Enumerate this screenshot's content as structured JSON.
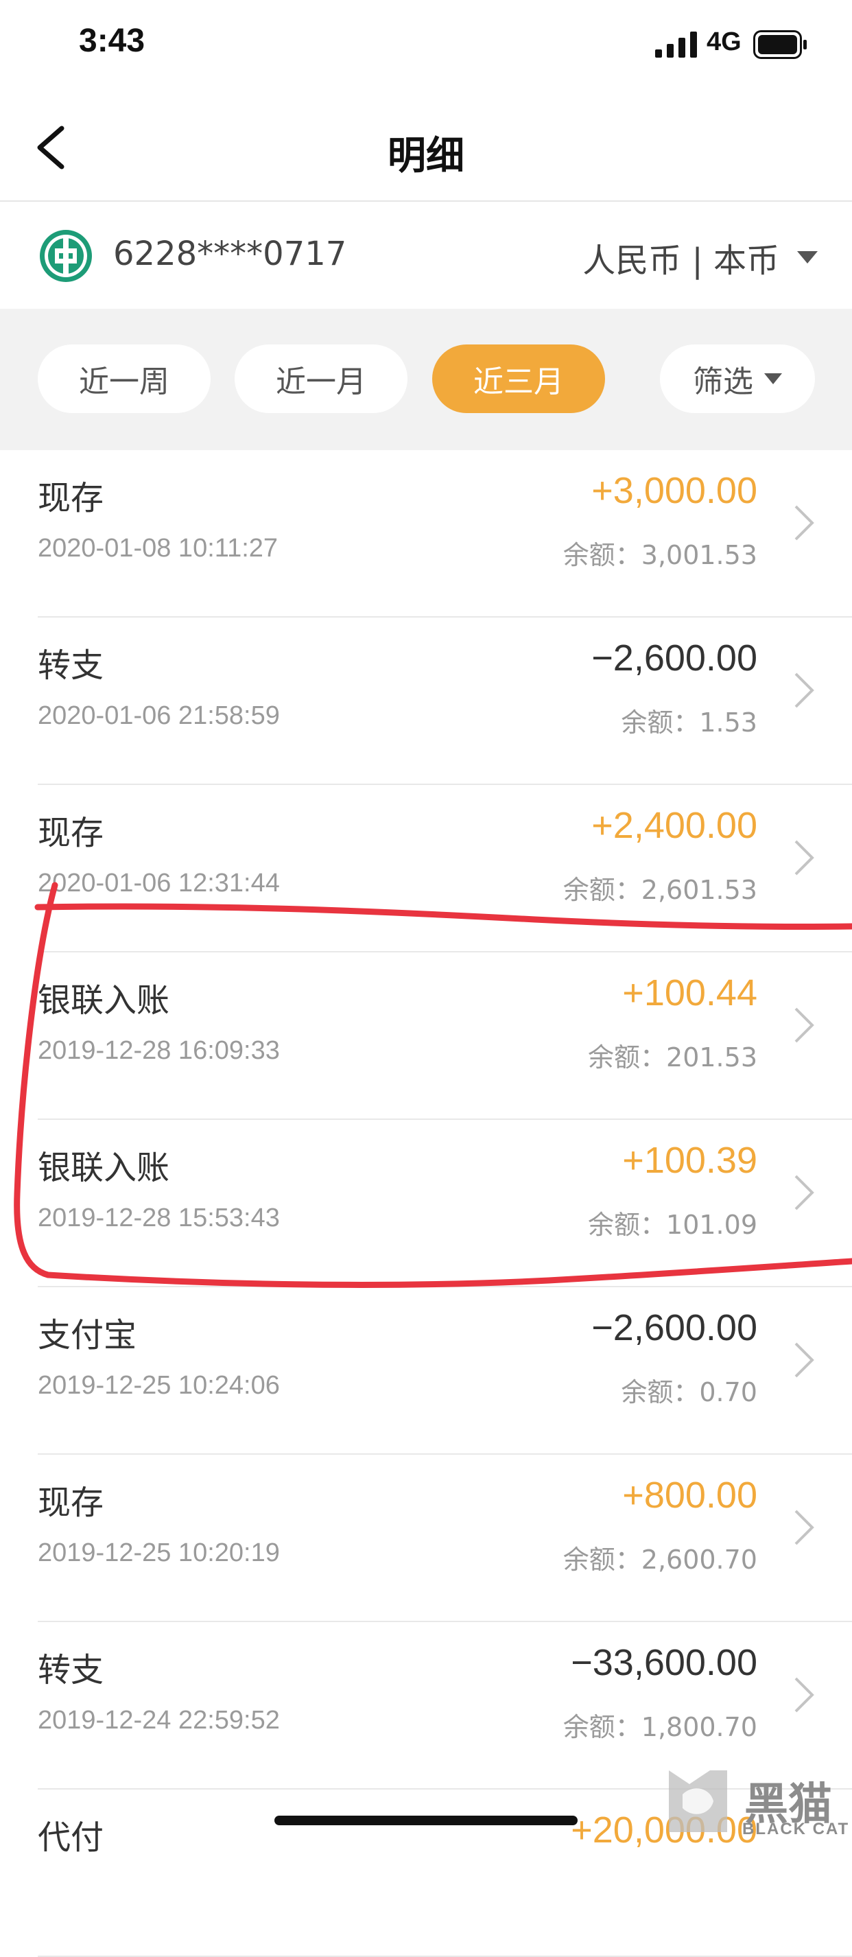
{
  "status_bar": {
    "time": "3:43",
    "network": "4G",
    "icons": [
      "signal-icon",
      "battery-icon"
    ]
  },
  "nav": {
    "title": "明细",
    "back_icon": "chevron-left-icon"
  },
  "account": {
    "bank_logo_icon": "bank-logo-icon",
    "number": "6228****0717",
    "currency": "人民币 | 本币",
    "currency_icon": "caret-down-icon"
  },
  "filters": {
    "items": [
      {
        "label": "近一周",
        "active": false
      },
      {
        "label": "近一月",
        "active": false
      },
      {
        "label": "近三月",
        "active": true
      },
      {
        "label": "筛选",
        "active": false
      }
    ],
    "accent_color": "#f2a93b"
  },
  "transactions": [
    {
      "type": "现存",
      "time": "2020-01-08 10:11:27",
      "amount": "+3,000.00",
      "balance": "余额：3,001.53",
      "kind": "income"
    },
    {
      "type": "转支",
      "time": "2020-01-06 21:58:59",
      "amount": "−2,600.00",
      "balance": "余额：1.53",
      "kind": "expense"
    },
    {
      "type": "现存",
      "time": "2020-01-06 12:31:44",
      "amount": "+2,400.00",
      "balance": "余额：2,601.53",
      "kind": "income"
    },
    {
      "type": "银联入账",
      "time": "2019-12-28 16:09:33",
      "amount": "+100.44",
      "balance": "余额：201.53",
      "kind": "income"
    },
    {
      "type": "银联入账",
      "time": "2019-12-28 15:53:43",
      "amount": "+100.39",
      "balance": "余额：101.09",
      "kind": "income"
    },
    {
      "type": "支付宝",
      "time": "2019-12-25 10:24:06",
      "amount": "−2,600.00",
      "balance": "余额：0.70",
      "kind": "expense"
    },
    {
      "type": "现存",
      "time": "2019-12-25 10:20:19",
      "amount": "+800.00",
      "balance": "余额：2,600.70",
      "kind": "income"
    },
    {
      "type": "转支",
      "time": "2019-12-24 22:59:52",
      "amount": "−33,600.00",
      "balance": "余额：1,800.70",
      "kind": "expense"
    },
    {
      "type": "代付",
      "time": "",
      "amount": "+20,000.00",
      "balance": "",
      "kind": "income"
    }
  ],
  "annotation": {
    "color": "#e8343f"
  },
  "watermark": {
    "text": "黑猫",
    "sub": "BLACK CAT"
  }
}
